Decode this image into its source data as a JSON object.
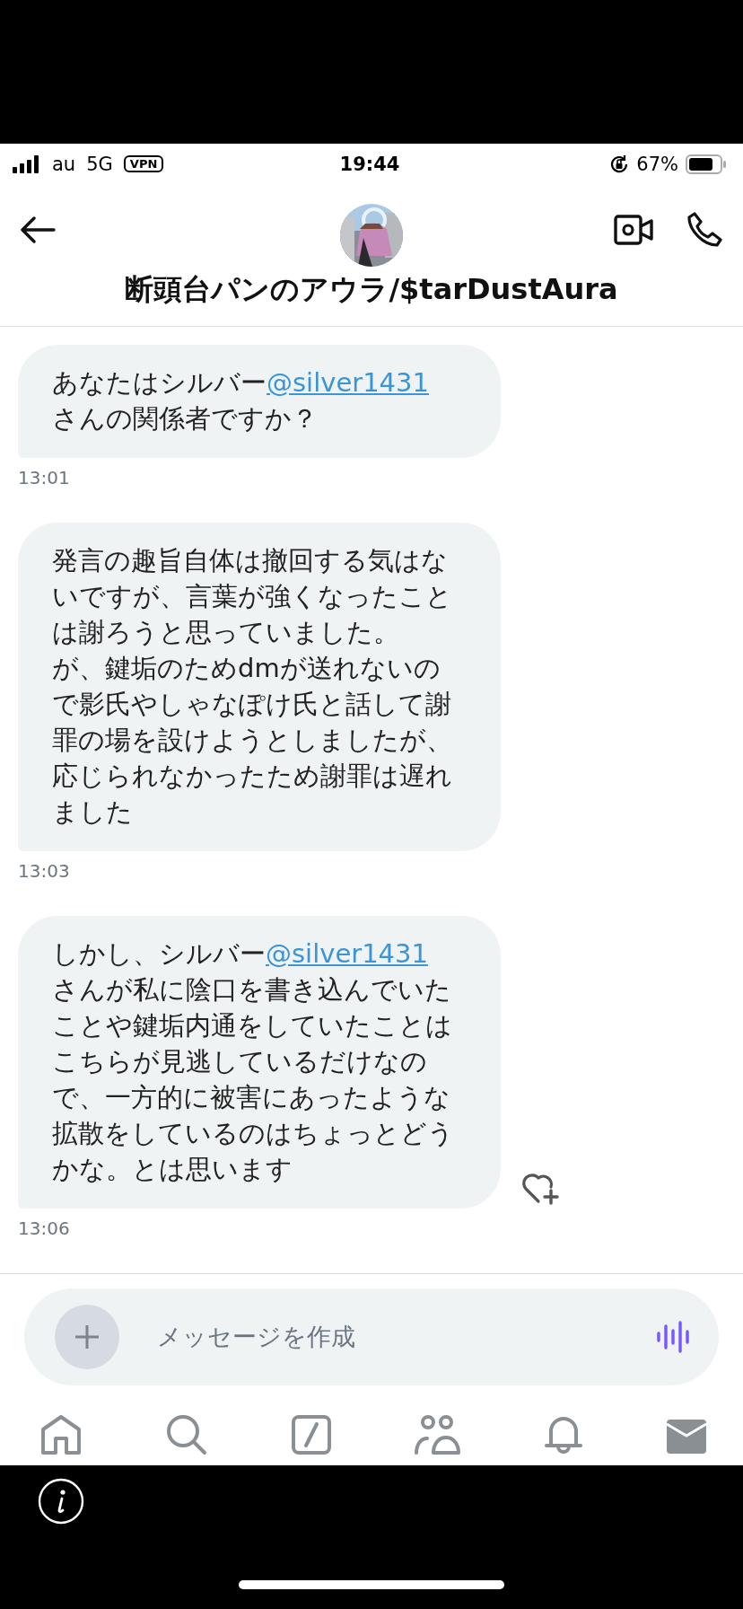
{
  "status_bar": {
    "carrier": "au",
    "network": "5G",
    "vpn": "VPN",
    "time": "19:44",
    "battery": "67%"
  },
  "header": {
    "title": "断頭台パンのアウラ/$tarDustAura"
  },
  "messages": [
    {
      "parts": [
        {
          "kind": "text",
          "text": "あなたはシルバー"
        },
        {
          "kind": "mention",
          "text": "@silver1431"
        },
        {
          "kind": "text",
          "text": " さんの関係者ですか？"
        }
      ],
      "time": "13:01",
      "reaction_button": false
    },
    {
      "parts": [
        {
          "kind": "text",
          "text": "発言の趣旨自体は撤回する気はないですが、言葉が強くなったことは謝ろうと思っていました。"
        },
        {
          "kind": "break"
        },
        {
          "kind": "text",
          "text": "が、鍵垢のためdmが送れないので影氏やしゃなぽけ氏と話して謝罪の場を設けようとしましたが、応じられなかったため謝罪は遅れました"
        }
      ],
      "time": "13:03",
      "reaction_button": false
    },
    {
      "parts": [
        {
          "kind": "text",
          "text": "しかし、シルバー"
        },
        {
          "kind": "mention",
          "text": "@silver1431"
        },
        {
          "kind": "text",
          "text": " さんが私に陰口を書き込んでいたことや鍵垢内通をしていたことはこちらが見逃しているだけなので、一方的に被害にあったような拡散をしているのはちょっとどうかな。とは思います"
        }
      ],
      "time": "13:06",
      "reaction_button": true
    }
  ],
  "composer": {
    "placeholder": "メッセージを作成"
  },
  "nav": [
    {
      "kind": "home",
      "selected": false
    },
    {
      "kind": "search",
      "selected": false
    },
    {
      "kind": "spaces",
      "selected": false
    },
    {
      "kind": "communities",
      "selected": false
    },
    {
      "kind": "notifications",
      "selected": false
    },
    {
      "kind": "messages",
      "selected": true
    }
  ]
}
